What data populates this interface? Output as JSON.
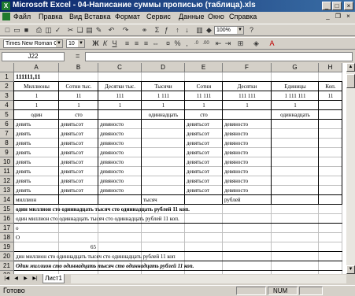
{
  "window": {
    "title": "Microsoft Excel - 04-Написание суммы прописью (таблица).xls",
    "min_glyph": "_",
    "max_glyph": "□",
    "close_glyph": "×"
  },
  "menu": [
    "Файл",
    "Правка",
    "Вид",
    "Вставка",
    "Формат",
    "Сервис",
    "Данные",
    "Окно",
    "Справка"
  ],
  "toolbar": {
    "zoom": "100%",
    "font_name": "Times New Roman Cyr",
    "font_size": "10",
    "icons": [
      "new-icon",
      "open-icon",
      "save-icon",
      "print-icon",
      "preview-icon",
      "spell-icon",
      "cut-icon",
      "copy-icon",
      "paste-icon",
      "format-painter-icon",
      "undo-icon",
      "redo-icon",
      "hyperlink-icon",
      "autosum-icon",
      "function-icon",
      "sort-asc-icon",
      "sort-desc-icon",
      "chart-wizard-icon",
      "drawing-icon",
      "help-icon"
    ],
    "format_icons": [
      "bold-icon",
      "italic-icon",
      "underline-icon",
      "align-left-icon",
      "align-center-icon",
      "align-right-icon",
      "merge-center-icon",
      "currency-icon",
      "percent-icon",
      "comma-icon",
      "increase-decimal-icon",
      "decrease-decimal-icon",
      "indent-decrease-icon",
      "indent-increase-icon",
      "borders-icon",
      "fill-color-icon",
      "font-color-icon"
    ]
  },
  "formula_bar": {
    "name_box": "J22",
    "equals": "=",
    "content": ""
  },
  "grid": {
    "columns": [
      "A",
      "B",
      "C",
      "D",
      "E",
      "F",
      "G",
      "H"
    ],
    "rows": [
      "1",
      "2",
      "3",
      "4",
      "5",
      "6",
      "7",
      "8",
      "9",
      "10",
      "11",
      "12",
      "13",
      "14",
      "15",
      "16",
      "17",
      "18",
      "19",
      "20",
      "21",
      "22"
    ],
    "cells": {
      "A1": "111111,11",
      "A2": "Миллионы",
      "B2": "Сотни тыс.",
      "C2": "Десятки тыс.",
      "D2": "Тысячи",
      "E2": "Сотни",
      "F2": "Десятки",
      "G2": "Единицы",
      "H2": "Коп.",
      "A3": "1",
      "B3": "11",
      "C3": "111",
      "D3": "1 111",
      "E3": "11 111",
      "F3": "111 111",
      "G3": "1 111 111",
      "H3": "11",
      "A4": "1",
      "B4": "1",
      "C4": "1",
      "D4": "1",
      "E4": "1",
      "F4": "1",
      "G4": "1",
      "A5": "один",
      "B5": "сто",
      "D5": "одиннадцать",
      "E5": "сто",
      "G5": "одиннадцать",
      "A6": "девять",
      "B6": "девятьсот",
      "C6": "девяносто",
      "E6": "девятьсот",
      "F6": "девяносто",
      "A7": "девять",
      "B7": "девятьсот",
      "C7": "девяносто",
      "E7": "девятьсот",
      "F7": "девяносто",
      "A8": "девять",
      "B8": "девятьсот",
      "C8": "девяносто",
      "E8": "девятьсот",
      "F8": "девяносто",
      "A9": "девять",
      "B9": "девятьсот",
      "C9": "девяносто",
      "E9": "девятьсот",
      "F9": "девяносто",
      "A10": "девять",
      "B10": "девятьсот",
      "C10": "девяносто",
      "E10": "девятьсот",
      "F10": "девяносто",
      "A11": "девять",
      "B11": "девятьсот",
      "C11": "девяносто",
      "E11": "девятьсот",
      "F11": "девяносто",
      "A12": "девять",
      "B12": "девятьсот",
      "C12": "девяносто",
      "E12": "девятьсот",
      "F12": "девяносто",
      "A13": "девять",
      "B13": "девятьсот",
      "C13": "девяносто",
      "E13": "девятьсот",
      "F13": "девяносто",
      "A14": "миллион",
      "D14": "тысяч",
      "F14": "рублей",
      "A15": "один миллион сто одиннадцать тысяч сто одиннадцать рублей 11 коп.",
      "A16": "один миллион сто одиннадцать тысяч сто одиннадцать рублей 11 коп.",
      "A17": "о",
      "A18": "О",
      "B19": "65",
      "A20": "дин миллион сто одиннадцать тысяч сто одиннадцать рублей 11 коп",
      "A21": "Один миллион сто одиннадцать тысяч сто одиннадцать рублей 11 коп."
    }
  },
  "sheet_tabs": [
    "Лист1"
  ],
  "status": {
    "text": "Готово",
    "num": "NUM"
  }
}
